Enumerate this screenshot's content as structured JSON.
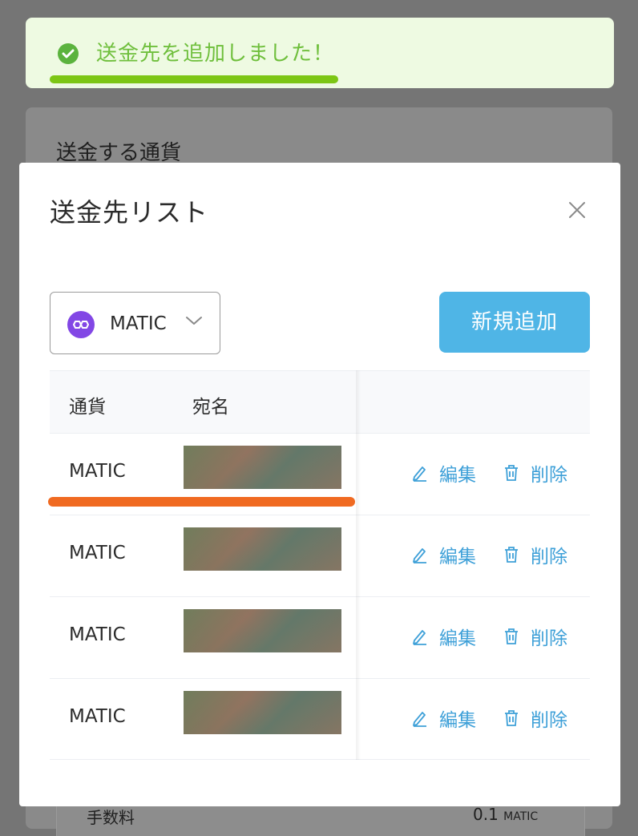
{
  "background": {
    "section_title": "送金する通貨",
    "fee_label": "手数料",
    "fee_value": "0.1",
    "fee_unit": "MATIC"
  },
  "toast": {
    "message": "送金先を追加しました！",
    "progress_percent": 49,
    "color": "#6fbf3c"
  },
  "modal": {
    "title": "送金先リスト",
    "currency_select": {
      "selected": "MATIC",
      "icon": "polygon-icon"
    },
    "add_button_label": "新規追加",
    "table": {
      "headers": {
        "currency": "通貨",
        "name": "宛名"
      },
      "rows": [
        {
          "currency": "MATIC",
          "edit_label": "編集",
          "delete_label": "削除"
        },
        {
          "currency": "MATIC",
          "edit_label": "編集",
          "delete_label": "削除"
        },
        {
          "currency": "MATIC",
          "edit_label": "編集",
          "delete_label": "削除"
        },
        {
          "currency": "MATIC",
          "edit_label": "編集",
          "delete_label": "削除"
        }
      ]
    }
  },
  "colors": {
    "accent_button": "#4fb5e6",
    "link": "#3ea0d8",
    "annotation": "#f06a21",
    "coin": "#8247e5"
  }
}
